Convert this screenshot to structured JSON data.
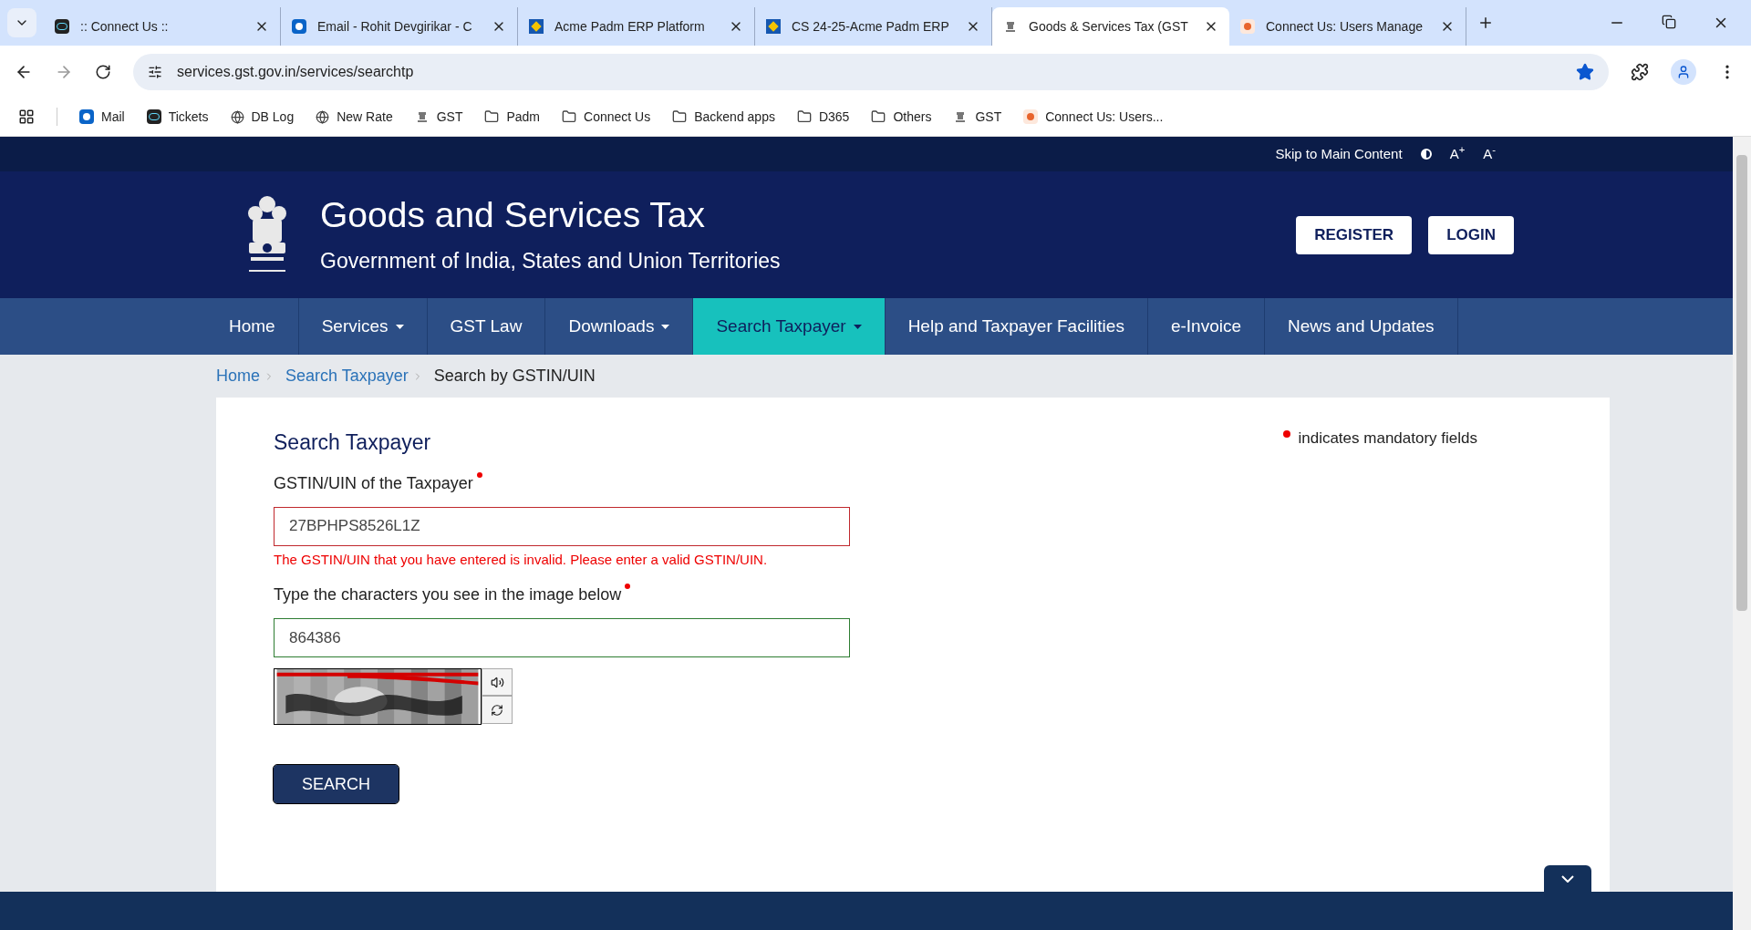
{
  "browser": {
    "tabs": [
      {
        "title": ":: Connect Us ::",
        "selected": false
      },
      {
        "title": "Email - Rohit Devgirikar - C",
        "selected": false
      },
      {
        "title": "Acme Padm ERP Platform",
        "selected": false
      },
      {
        "title": "CS 24-25-Acme Padm ERP",
        "selected": false
      },
      {
        "title": "Goods & Services Tax (GST",
        "selected": true
      },
      {
        "title": "Connect Us: Users Manage",
        "selected": false
      }
    ],
    "url": "services.gst.gov.in/services/searchtp",
    "bookmarked": true,
    "bookmarks": [
      "Mail",
      "Tickets",
      "DB Log",
      "New Rate",
      "GST",
      "Padm",
      "Connect Us",
      "Backend apps",
      "D365",
      "Others",
      "GST",
      "Connect Us: Users..."
    ]
  },
  "top_strip": {
    "skip_link": "Skip to Main Content",
    "font_up": "A",
    "font_up_mark": "+",
    "font_down": "A",
    "font_down_mark": "-"
  },
  "header": {
    "title": "Goods and Services Tax",
    "subtitle": "Government of India, States and Union Territories",
    "buttons": [
      "REGISTER",
      "LOGIN"
    ]
  },
  "nav": [
    {
      "label": "Home",
      "dropdown": false,
      "selected": false
    },
    {
      "label": "Services",
      "dropdown": true,
      "selected": false
    },
    {
      "label": "GST Law",
      "dropdown": false,
      "selected": false
    },
    {
      "label": "Downloads",
      "dropdown": true,
      "selected": false
    },
    {
      "label": "Search Taxpayer",
      "dropdown": true,
      "selected": true
    },
    {
      "label": "Help and Taxpayer Facilities",
      "dropdown": false,
      "selected": false
    },
    {
      "label": "e-Invoice",
      "dropdown": false,
      "selected": false
    },
    {
      "label": "News and Updates",
      "dropdown": false,
      "selected": false
    }
  ],
  "breadcrumb": [
    {
      "label": "Home",
      "link": true
    },
    {
      "label": "Search Taxpayer",
      "link": true
    },
    {
      "label": "Search by GSTIN/UIN",
      "link": false
    }
  ],
  "form": {
    "title": "Search Taxpayer",
    "mandatory_note": "indicates mandatory fields",
    "fields": [
      {
        "label": "GSTIN/UIN of the Taxpayer",
        "value": "27BPHPS8526L1Z",
        "invalid": true,
        "error": "The GSTIN/UIN that you have entered is invalid. Please enter a valid GSTIN/UIN."
      },
      {
        "label": "Type the characters you see in the image below",
        "value": "864386",
        "invalid": false
      }
    ],
    "submit": "SEARCH"
  }
}
